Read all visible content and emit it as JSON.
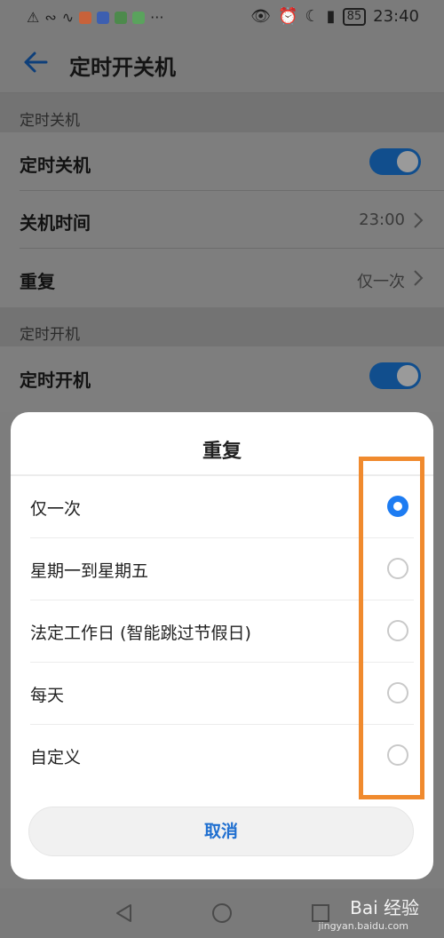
{
  "status_bar": {
    "time": "23:40",
    "battery": "85",
    "left_icons": [
      "alert-icon",
      "wifi-icon",
      "activity-icon",
      "app-icon-1",
      "app-icon-2",
      "app-icon-3",
      "app-icon-4"
    ],
    "more": "···"
  },
  "header": {
    "title": "定时开关机"
  },
  "sections": {
    "off": {
      "header": "定时关机",
      "toggle_label": "定时关机",
      "time_label": "关机时间",
      "time_value": "23:00",
      "repeat_label": "重复",
      "repeat_value": "仅一次"
    },
    "on": {
      "header": "定时开机",
      "toggle_label": "定时开机"
    }
  },
  "dialog": {
    "title": "重复",
    "options": [
      {
        "label": "仅一次",
        "selected": true
      },
      {
        "label": "星期一到星期五",
        "selected": false
      },
      {
        "label": "法定工作日 (智能跳过节假日)",
        "selected": false
      },
      {
        "label": "每天",
        "selected": false
      },
      {
        "label": "自定义",
        "selected": false
      }
    ],
    "cancel_label": "取消"
  },
  "watermark": {
    "text": "Bai 经验",
    "sub": "jingyan.baidu.com"
  },
  "colors": {
    "accent": "#1d7cf2",
    "highlight": "#f08a2e",
    "toggle_on": "#114e8d"
  }
}
